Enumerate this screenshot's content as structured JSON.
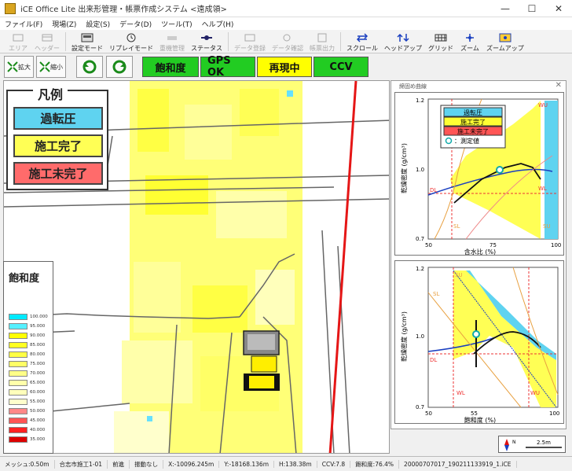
{
  "window": {
    "title": "iCE Office Lite 出来形管理・帳票作成システム <遠成領>",
    "minimize": "—",
    "maximize": "☐",
    "close": "✕"
  },
  "menu": [
    "ファイル(F)",
    "現場(Z)",
    "設定(S)",
    "データ(D)",
    "ツール(T)",
    "ヘルプ(H)"
  ],
  "toolbar": [
    {
      "label": "エリア",
      "icon": "area-icon",
      "enabled": false
    },
    {
      "label": "ヘッダー",
      "icon": "header-icon",
      "enabled": false
    },
    {
      "label": "設定モード",
      "icon": "settings-mode-icon",
      "enabled": true
    },
    {
      "label": "リプレイモード",
      "icon": "replay-mode-icon",
      "enabled": true
    },
    {
      "label": "重機管理",
      "icon": "machine-icon",
      "enabled": false
    },
    {
      "label": "ステータス",
      "icon": "status-icon",
      "enabled": true
    },
    {
      "label": "データ登録",
      "icon": "data-register-icon",
      "enabled": false
    },
    {
      "label": "データ確認",
      "icon": "data-check-icon",
      "enabled": false
    },
    {
      "label": "帳票出力",
      "icon": "report-icon",
      "enabled": false
    },
    {
      "label": "スクロール",
      "icon": "scroll-icon",
      "enabled": true
    },
    {
      "label": "ヘッドアップ",
      "icon": "headup-icon",
      "enabled": true
    },
    {
      "label": "グリッド",
      "icon": "grid-icon",
      "enabled": true
    },
    {
      "label": "ズーム",
      "icon": "zoom-icon",
      "enabled": true
    },
    {
      "label": "ズームアップ",
      "icon": "zoomup-icon",
      "enabled": true
    }
  ],
  "zoom_in_label": "拡大",
  "zoom_out_label": "縮小",
  "modes": [
    {
      "label": "飽和度",
      "bg": "#22cc22",
      "color": "#111"
    },
    {
      "label": "GPS OK",
      "bg": "#22cc22",
      "color": "#111"
    },
    {
      "label": "再現中",
      "bg": "#ffff00",
      "color": "#111"
    },
    {
      "label": "CCV",
      "bg": "#22cc22",
      "color": "#111"
    }
  ],
  "legend": {
    "title": "凡例",
    "items": [
      {
        "label": "過転圧",
        "color": "#5fd3f0"
      },
      {
        "label": "施工完了",
        "color": "#ffff55"
      },
      {
        "label": "施工未完了",
        "color": "#ff6b6b"
      }
    ]
  },
  "saturation_panel": {
    "title": "飽和度",
    "levels": [
      {
        "label": "100.000",
        "color": "#00eaff"
      },
      {
        "label": "95.000",
        "color": "#55f0ff"
      },
      {
        "label": "90.000",
        "color": "#ffff00"
      },
      {
        "label": "85.000",
        "color": "#ffff22"
      },
      {
        "label": "80.000",
        "color": "#ffff44"
      },
      {
        "label": "75.000",
        "color": "#ffff66"
      },
      {
        "label": "70.000",
        "color": "#ffff88"
      },
      {
        "label": "65.000",
        "color": "#ffffaa"
      },
      {
        "label": "60.000",
        "color": "#ffffbb"
      },
      {
        "label": "55.000",
        "color": "#ffffcc"
      },
      {
        "label": "50.000",
        "color": "#ff8888"
      },
      {
        "label": "45.000",
        "color": "#ff5555"
      },
      {
        "label": "40.000",
        "color": "#ff2222"
      },
      {
        "label": "35.000",
        "color": "#dd0000"
      }
    ]
  },
  "graph_window": {
    "title": "締固め曲線",
    "close": "✕",
    "graph1": {
      "legend": [
        {
          "label": "過転圧",
          "color": "#5fd3f0"
        },
        {
          "label": "施工完了",
          "color": "#ffff33"
        },
        {
          "label": "施工未完了",
          "color": "#ff5555"
        },
        {
          "label": "：測定値",
          "color": "#ffffff"
        }
      ],
      "ylabel": "乾燥密度 (g/cm³)",
      "xlabel": "含水比 (%)",
      "yticks": [
        "1.2",
        "1.0",
        "0.7"
      ],
      "xticks": [
        "50",
        "75",
        "100"
      ],
      "marks": [
        "DL",
        "SL",
        "SU",
        "WU",
        "WL"
      ]
    },
    "graph2": {
      "ylabel": "乾燥密度 (g/cm³)",
      "xlabel": "飽和度 (%)",
      "yticks": [
        "1.2",
        "1.0",
        "0.7"
      ],
      "xticks": [
        "50",
        "55",
        "100"
      ],
      "marks": [
        "DL",
        "SL",
        "SU",
        "WL",
        "WU"
      ]
    }
  },
  "scalebar_label": "2.5m",
  "compass_label": "N",
  "status": [
    "メッシュ:0.50m",
    "合志市施工1-01",
    "前進",
    "振動なし",
    "X:-10096.245m",
    "Y:-18168.136m",
    "H:138.38m",
    "CCV:7.8",
    "飽和度:76.4%",
    "20000707017_190211133919_1.iCE"
  ]
}
